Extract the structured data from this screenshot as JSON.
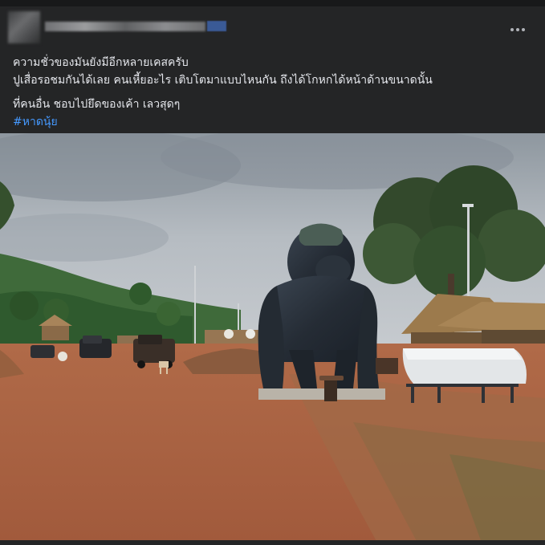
{
  "post": {
    "text_lines": [
      "ความชั่วของมันยังมีอีกหลายเคสครับ",
      "ปูเสื่อรอชมกันได้เลย คนเหี้ยอะไร เติบโตมาแบบไหนกัน ถึงได้โกหกได้หน้าด้านขนาดนั้น",
      "ที่คนอื่น ชอบไปยึดของเค้า เลวสุดๆ"
    ],
    "hashtag": "#หาดนุ้ย"
  },
  "icons": {
    "more_options": "more-horizontal-icon"
  },
  "colors": {
    "card_background": "#242526",
    "text": "#e4e6eb",
    "link": "#4599ff"
  }
}
